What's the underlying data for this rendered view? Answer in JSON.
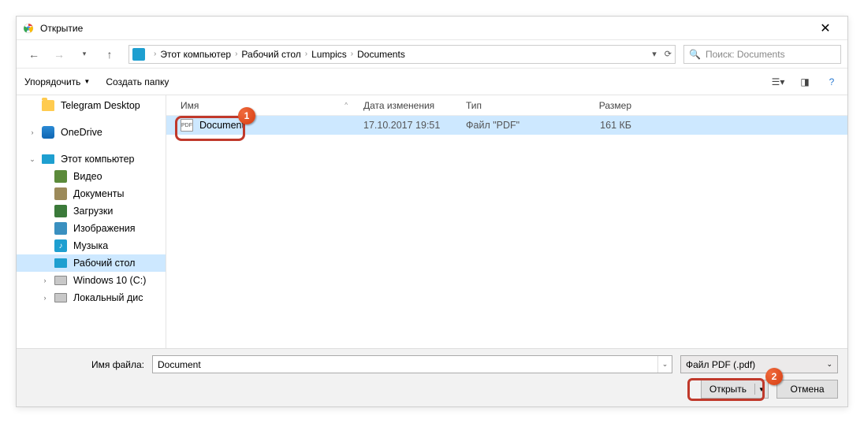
{
  "window": {
    "title": "Открытие"
  },
  "nav": {
    "breadcrumb": [
      "Этот компьютер",
      "Рабочий стол",
      "Lumpics",
      "Documents"
    ],
    "search_placeholder": "Поиск: Documents"
  },
  "toolbar": {
    "organize": "Упорядочить",
    "newfolder": "Создать папку"
  },
  "sidebar": {
    "items": [
      {
        "label": "Telegram Desktop",
        "icon": "folder"
      },
      {
        "label": "OneDrive",
        "icon": "onedrive",
        "caret": ">"
      },
      {
        "label": "Этот компьютер",
        "icon": "monitor",
        "caret": "v"
      },
      {
        "label": "Видео",
        "icon": "video"
      },
      {
        "label": "Документы",
        "icon": "docs"
      },
      {
        "label": "Загрузки",
        "icon": "downloads"
      },
      {
        "label": "Изображения",
        "icon": "images"
      },
      {
        "label": "Музыка",
        "icon": "music"
      },
      {
        "label": "Рабочий стол",
        "icon": "desktop",
        "selected": true
      },
      {
        "label": "Windows 10 (C:)",
        "icon": "disk",
        "caret": ">"
      },
      {
        "label": "Локальный дис",
        "icon": "disk",
        "caret": ">"
      }
    ]
  },
  "columns": {
    "name": "Имя",
    "date": "Дата изменения",
    "type": "Тип",
    "size": "Размер"
  },
  "files": [
    {
      "name": "Document",
      "date": "17.10.2017 19:51",
      "type": "Файл \"PDF\"",
      "size": "161 КБ"
    }
  ],
  "footer": {
    "filename_label": "Имя файла:",
    "filename_value": "Document",
    "filter": "Файл PDF (.pdf)",
    "open": "Открыть",
    "cancel": "Отмена"
  },
  "markers": {
    "one": "1",
    "two": "2"
  }
}
